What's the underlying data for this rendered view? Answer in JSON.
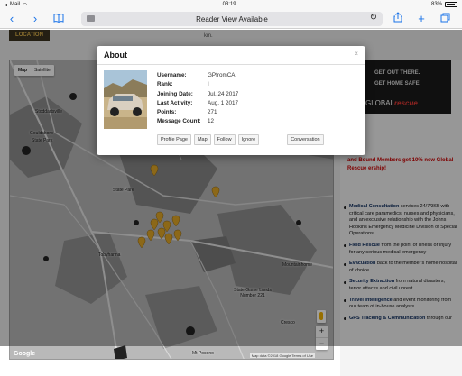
{
  "status_bar": {
    "carrier": "Mail",
    "time": "03:19",
    "battery": "83%"
  },
  "browser": {
    "address_text": "Reader View Available"
  },
  "page": {
    "location_badge": "LOCATION",
    "km_text": "km."
  },
  "map": {
    "type_buttons": [
      "Map",
      "Satellite"
    ],
    "labels": [
      "Stoddartsville",
      "Gouldsboro",
      "State Park",
      "State Park",
      "Tobyhanna",
      "Mountainhome",
      "State Game Lands Number 221",
      "Mt Pocono",
      "Cresco"
    ],
    "zoom_in": "+",
    "zoom_out": "−",
    "google": "Google",
    "footer": "Map data ©2018 Google  Terms of Use"
  },
  "ad": {
    "line1": "GET OUT THERE.",
    "line2": "GET HOME SAFE.",
    "brand_prefix": "GLOBAL",
    "brand_suffix": "rescue"
  },
  "promo": "and Bound Members get 10% new Global Rescue ership!",
  "features": [
    {
      "title": "Medical Consultation",
      "text": " services 24/7/365 with critical care paramedics, nurses and physicians, and an exclusive relationship with the Johns Hopkins Emergency Medicine Division of Special Operations"
    },
    {
      "title": "Field Rescue",
      "text": " from the point of illness or injury for any serious medical emergency"
    },
    {
      "title": "Evacuation",
      "text": " back to the member's home hospital of choice"
    },
    {
      "title": "Security Extraction",
      "text": " from natural disasters, terror attacks and civil unrest"
    },
    {
      "title": "Travel Intelligence",
      "text": " and event monitoring from our team of in-house analysts"
    },
    {
      "title": "GPS Tracking & Communication",
      "text": " through our"
    }
  ],
  "modal": {
    "title": "About",
    "close": "×",
    "fields": [
      {
        "key": "Username:",
        "value": "GPfromCA"
      },
      {
        "key": "Rank:",
        "value": "I"
      },
      {
        "key": "Joining Date:",
        "value": "Jul, 24 2017"
      },
      {
        "key": "Last Activity:",
        "value": "Aug, 1 2017"
      },
      {
        "key": "Points:",
        "value": "271"
      },
      {
        "key": "Message Count:",
        "value": "12"
      }
    ],
    "buttons": [
      "Profile Page",
      "Map",
      "Follow",
      "Ignore"
    ],
    "conversation": "Conversation"
  }
}
